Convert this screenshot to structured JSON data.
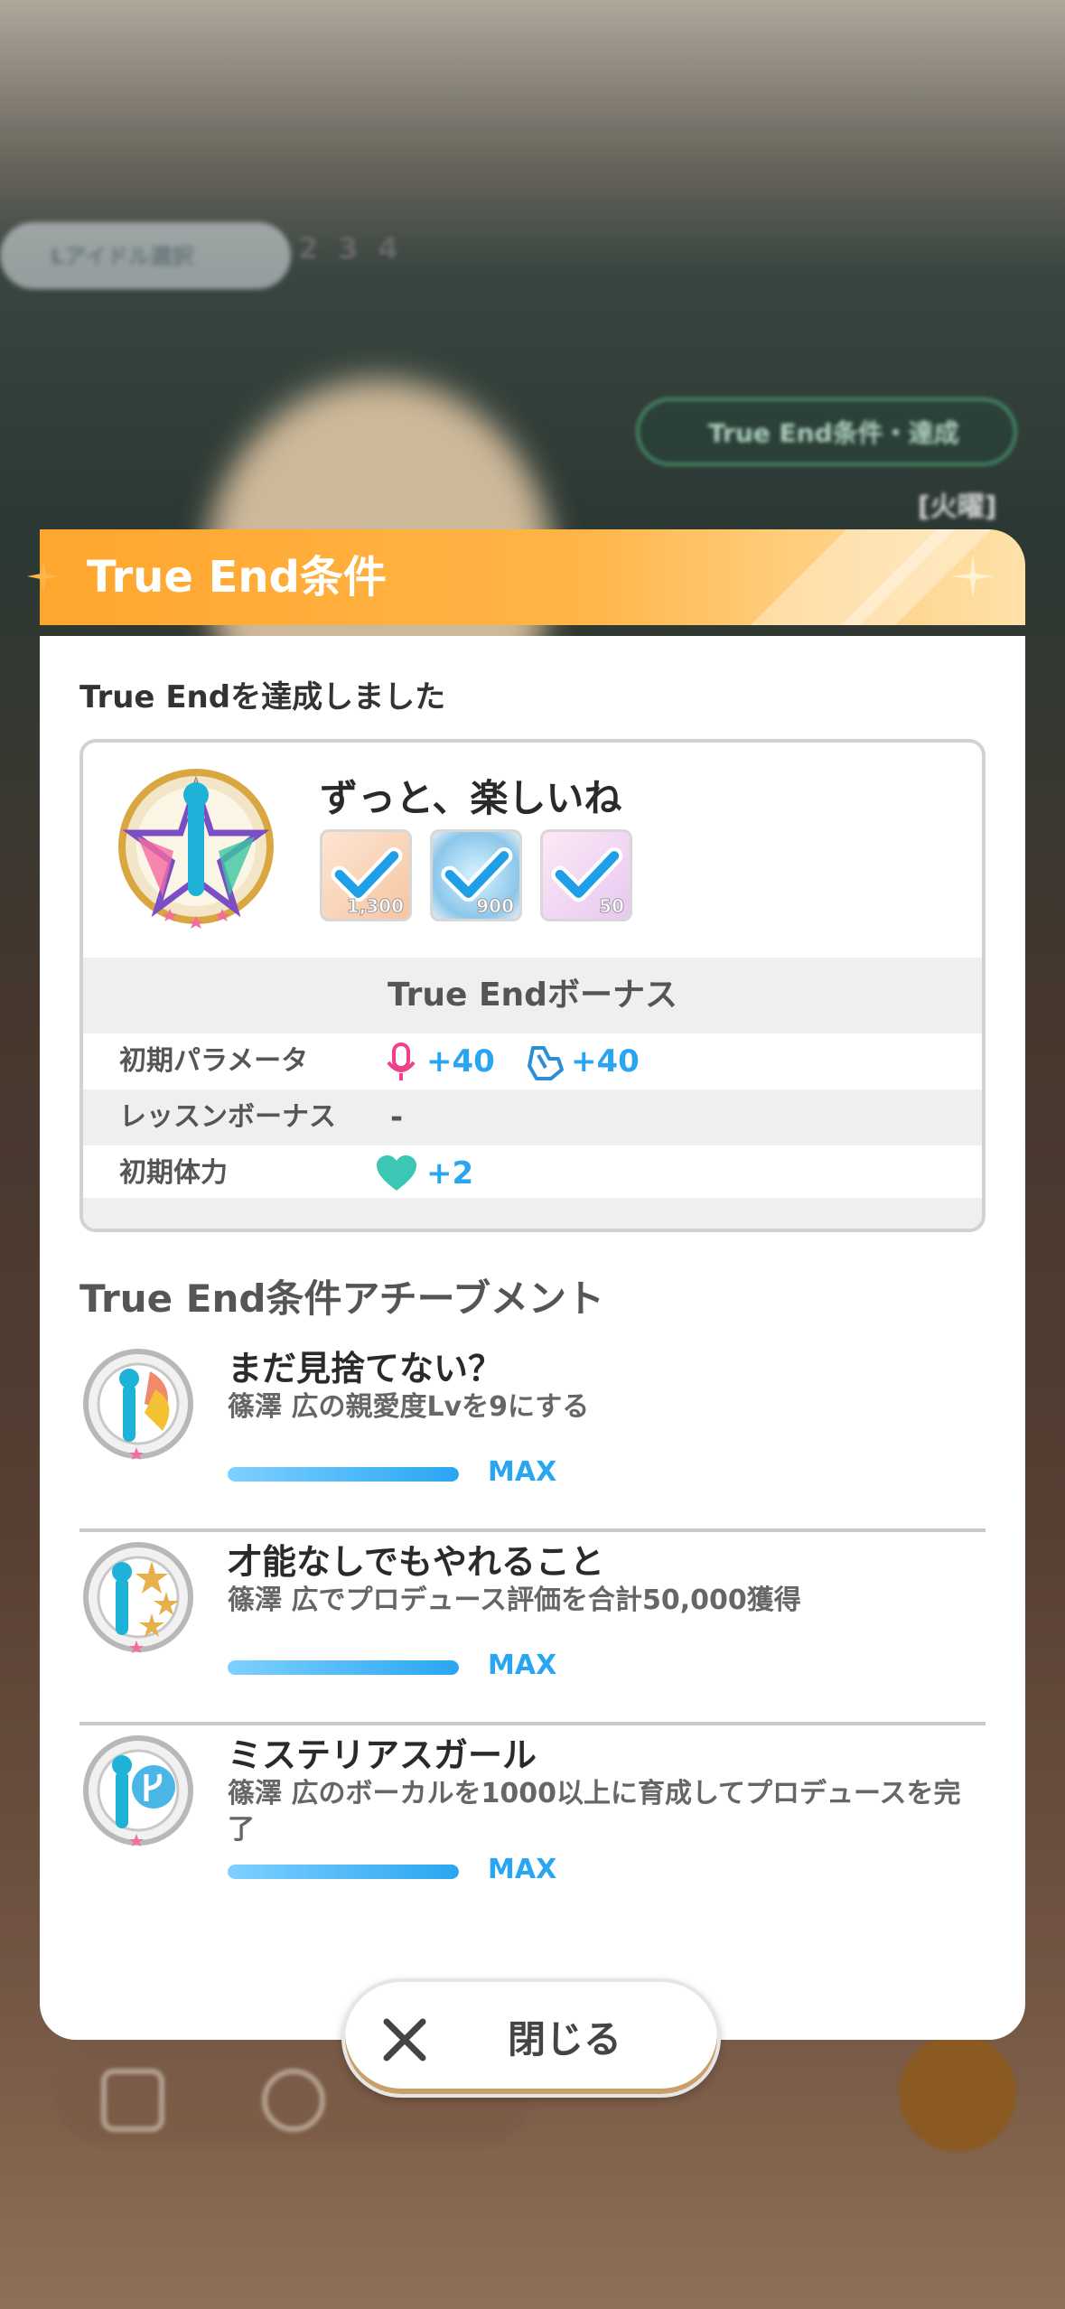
{
  "background": {
    "top_tab_label": "Lアイドル選択",
    "top_tab_numbers": [
      "2",
      "3",
      "4"
    ],
    "true_end_chip": "True End条件・達成",
    "tag_label": "[火曜]"
  },
  "panel": {
    "title": "True End条件",
    "achieved_label": "True Endを達成しました",
    "card": {
      "title": "ずっと、楽しいね",
      "rewards": [
        {
          "icon": "ticket-icon",
          "count": "1,300",
          "checked": true
        },
        {
          "icon": "coin-icon",
          "count": "900",
          "checked": true
        },
        {
          "icon": "card-icon",
          "count": "50",
          "checked": true
        }
      ],
      "bonus_heading": "True Endボーナス",
      "bonus_rows": [
        {
          "label": "初期パラメータ",
          "values": [
            {
              "icon": "vocal-mic-icon",
              "text": "+40"
            },
            {
              "icon": "visual-icon",
              "text": "+40"
            }
          ]
        },
        {
          "label": "レッスンボーナス",
          "values": [
            {
              "icon": "",
              "text": "-"
            }
          ]
        },
        {
          "label": "初期体力",
          "values": [
            {
              "icon": "heart-icon",
              "text": "+2"
            }
          ]
        }
      ]
    },
    "achievements_title": "True End条件アチーブメント",
    "achievements": [
      {
        "name": "まだ見捨てない？",
        "desc": "篠澤 広の親愛度Lvを9にする",
        "progress": 1.0,
        "status": "MAX",
        "badge_color": "#f08a6a"
      },
      {
        "name": "才能なしでもやれること",
        "desc": "篠澤 広でプロデュース評価を合計50,000獲得",
        "progress": 1.0,
        "status": "MAX",
        "badge_color": "#e6b04a"
      },
      {
        "name": "ミステリアスガール",
        "desc": "篠澤 広のボーカルを1000以上に育成してプロデュースを完了",
        "progress": 1.0,
        "status": "MAX",
        "badge_color": "#4ab6e6"
      }
    ]
  },
  "close_button": {
    "label": "閉じる"
  },
  "colors": {
    "accent": "#29a6f2",
    "header": "#ffa62e",
    "vocal": "#f0408a",
    "heart": "#3cc6b4"
  }
}
